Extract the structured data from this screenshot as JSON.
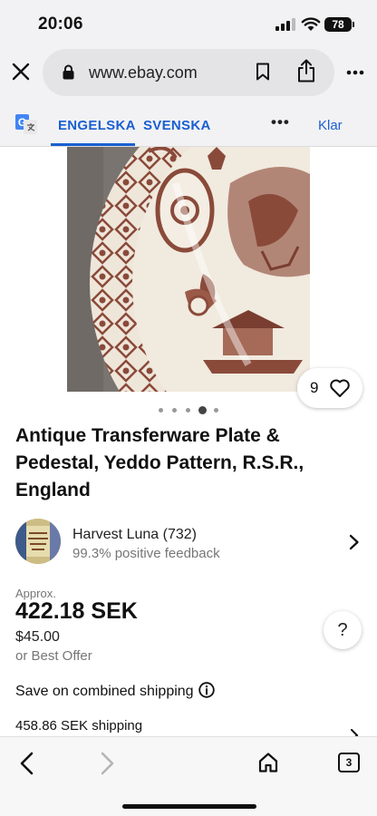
{
  "status_bar": {
    "time": "20:06",
    "battery": "78"
  },
  "browser": {
    "url": "www.ebay.com"
  },
  "translate_bar": {
    "tab_source": "ENGELSKA",
    "tab_target": "SVENSKA",
    "more": "•••",
    "done": "Klar"
  },
  "gallery": {
    "watch_count": "9",
    "total_images": 5,
    "active_index": 3
  },
  "listing": {
    "title": "Antique Transferware Plate & Pedestal, Yeddo Pattern, R.S.R., England"
  },
  "seller": {
    "name": "Harvest Luna (732)",
    "feedback": "99.3% positive feedback",
    "avatar_text": "Vintage Antiques"
  },
  "price": {
    "approx_label": "Approx.",
    "converted": "422.18 SEK",
    "original": "$45.00",
    "best_offer": "or Best Offer"
  },
  "help": {
    "label": "?"
  },
  "shipping": {
    "combined_label": "Save on combined shipping",
    "cost": "458.86 SEK shipping"
  },
  "toolbar": {
    "tab_count": "3"
  },
  "colors": {
    "accent": "#1a5fd1",
    "transferware": "#8a4a3a",
    "muted": "#767676"
  }
}
